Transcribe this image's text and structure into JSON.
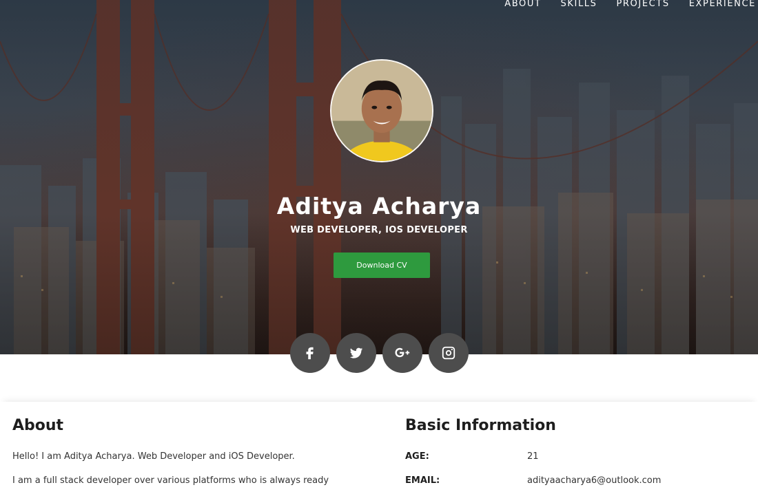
{
  "nav": {
    "items": [
      {
        "label": "ABOUT"
      },
      {
        "label": "SKILLS"
      },
      {
        "label": "PROJECTS"
      },
      {
        "label": "EXPERIENCE"
      }
    ]
  },
  "hero": {
    "name": "Aditya Acharya",
    "role": "WEB DEVELOPER, IOS DEVELOPER",
    "cv_button": "Download CV",
    "button_color": "#2e9a3e"
  },
  "social": [
    {
      "icon": "facebook-icon"
    },
    {
      "icon": "twitter-icon"
    },
    {
      "icon": "google-plus-icon"
    },
    {
      "icon": "instagram-icon"
    }
  ],
  "about": {
    "title": "About",
    "paragraph1": "Hello! I am Aditya Acharya. Web Developer and iOS Developer.",
    "paragraph2": "I am a full stack developer over various platforms who is always ready"
  },
  "basic_info": {
    "title": "Basic Information",
    "rows": [
      {
        "label": "AGE:",
        "value": "21"
      },
      {
        "label": "EMAIL:",
        "value": "adityaacharya6@outlook.com"
      }
    ]
  }
}
